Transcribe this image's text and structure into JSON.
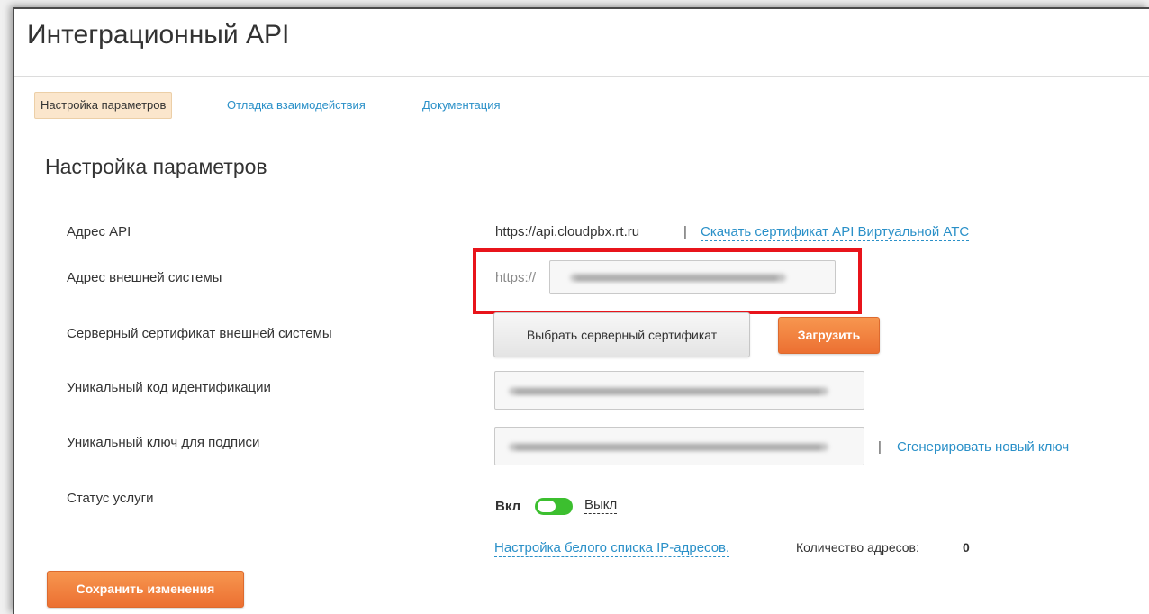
{
  "page": {
    "title": "Интеграционный API"
  },
  "tabs": [
    {
      "label": "Настройка параметров",
      "active": true
    },
    {
      "label": "Отладка взаимодействия",
      "active": false
    },
    {
      "label": "Документация",
      "active": false
    }
  ],
  "section_title": "Настройка параметров",
  "form": {
    "api_address": {
      "label": "Адрес API",
      "value": "https://api.cloudpbx.rt.ru",
      "separator": "|",
      "cert_link": "Скачать сертификат API Виртуальной АТС"
    },
    "external_address": {
      "label": "Адрес внешней системы",
      "prefix": "https://"
    },
    "server_cert": {
      "label": "Серверный сертификат внешней системы",
      "choose_button": "Выбрать серверный сертификат",
      "upload_button": "Загрузить"
    },
    "unique_code": {
      "label": "Уникальный код идентификации"
    },
    "signing_key": {
      "label": "Уникальный ключ для подписи",
      "separator": "|",
      "generate_link": "Сгенерировать новый ключ"
    },
    "status": {
      "label": "Статус услуги",
      "on_label": "Вкл",
      "off_label": "Выкл",
      "enabled": true
    },
    "whitelist": {
      "link": "Настройка белого списка IP-адресов.",
      "count_label": "Количество адресов:",
      "count": "0"
    }
  },
  "save_button": "Сохранить изменения",
  "colors": {
    "link": "#2a90c8",
    "accent_orange": "#ec7032",
    "highlight_box": "#e8141b",
    "toggle_on": "#3cbf2f",
    "active_tab_bg": "#fbe6cc"
  }
}
